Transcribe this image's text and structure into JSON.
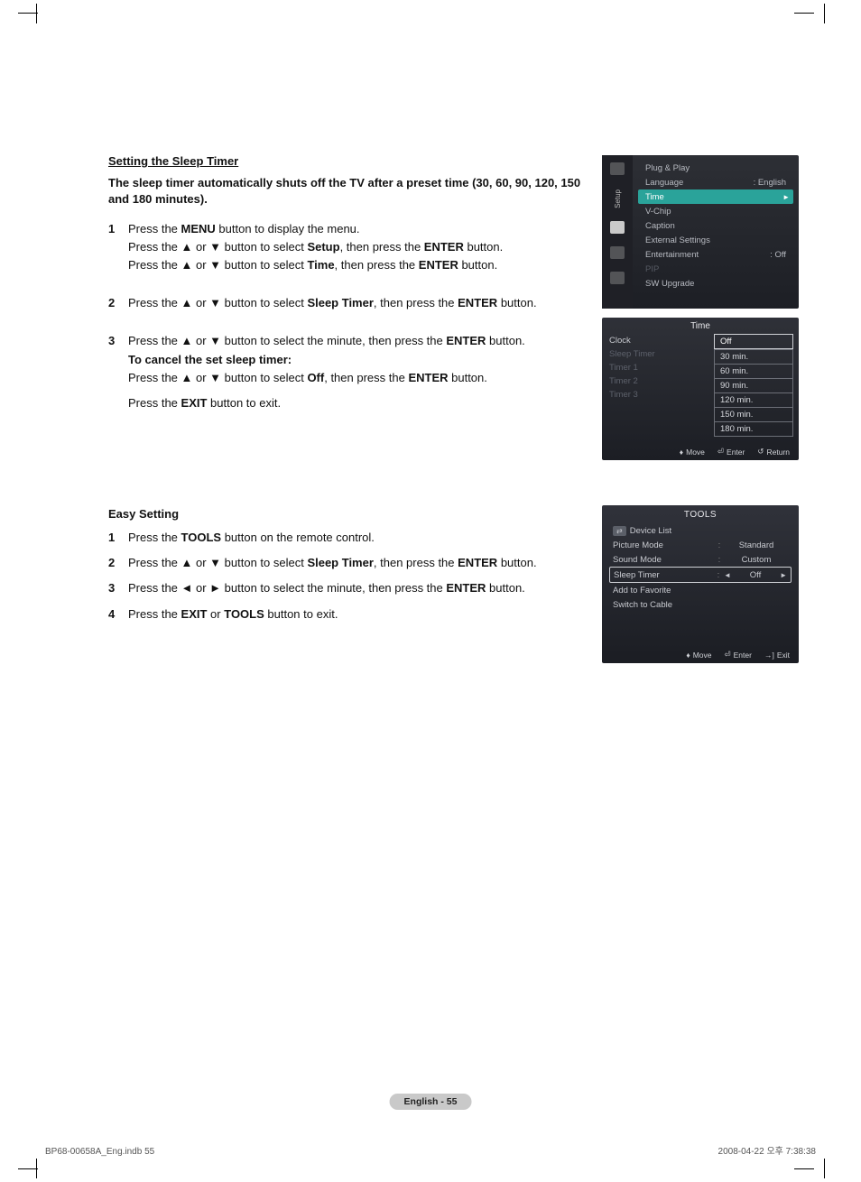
{
  "section1": {
    "title": "Setting the Sleep Timer",
    "intro": "The sleep timer automatically shuts off the TV after a preset time (30, 60, 90, 120, 150 and 180 minutes).",
    "steps": [
      {
        "num": "1",
        "lines": [
          {
            "pre": "Press the ",
            "b": "MENU",
            "post": " button to display the menu."
          },
          {
            "pre": "Press the ▲ or ▼ button to select ",
            "b": "Setup",
            "mid": ", then press the ",
            "b2": "ENTER",
            "post": " button."
          },
          {
            "pre": "Press the ▲ or ▼ button to select ",
            "b": "Time",
            "mid": ", then press the ",
            "b2": "ENTER",
            "post": " button."
          }
        ]
      },
      {
        "num": "2",
        "lines": [
          {
            "pre": "Press the ▲ or ▼ button to select ",
            "b": "Sleep Timer",
            "mid": ", then press the ",
            "b2": "ENTER",
            "post": " button."
          }
        ]
      },
      {
        "num": "3",
        "lines": [
          {
            "pre": "Press the ▲ or ▼ button to select the minute, then press the ",
            "b": "ENTER",
            "post": " button."
          },
          {
            "boldline": "To cancel the set sleep timer:"
          },
          {
            "pre": "Press the ▲ or ▼ button to select ",
            "b": "Off",
            "mid": ", then press the ",
            "b2": "ENTER",
            "post": " button."
          },
          {
            "spacer": true
          },
          {
            "pre": "Press the ",
            "b": "EXIT",
            "post": " button to exit."
          }
        ]
      }
    ]
  },
  "section2": {
    "title": "Easy Setting",
    "steps": [
      {
        "num": "1",
        "pre": "Press the ",
        "b": "TOOLS",
        "post": " button on the remote control."
      },
      {
        "num": "2",
        "pre": "Press the ▲ or ▼ button to select ",
        "b": "Sleep Timer",
        "mid": ", then press the ",
        "b2": "ENTER",
        "post": " button."
      },
      {
        "num": "3",
        "pre": "Press the ◄ or ► button to select the minute, then press the ",
        "b": "ENTER",
        "post": " button."
      },
      {
        "num": "4",
        "pre": "Press the ",
        "b": "EXIT",
        "mid": " or ",
        "b2": "TOOLS",
        "post": " button to exit."
      }
    ]
  },
  "osd_setup": {
    "sidebar_label": "Setup",
    "items": [
      {
        "label": "Plug & Play",
        "val": ""
      },
      {
        "label": "Language",
        "val": ": English"
      },
      {
        "label": "Time",
        "val": "",
        "sel": true
      },
      {
        "label": "V-Chip",
        "val": ""
      },
      {
        "label": "Caption",
        "val": ""
      },
      {
        "label": "External Settings",
        "val": ""
      },
      {
        "label": "Entertainment",
        "val": ": Off"
      },
      {
        "label": "PIP",
        "val": "",
        "dim": true
      },
      {
        "label": "SW Upgrade",
        "val": ""
      }
    ]
  },
  "osd_time": {
    "title": "Time",
    "left": [
      "Clock",
      "Sleep Timer",
      "Timer 1",
      "Timer 2",
      "Timer 3"
    ],
    "options": [
      "Off",
      "30 min.",
      "60 min.",
      "90 min.",
      "120 min.",
      "150 min.",
      "180 min."
    ],
    "footer": {
      "move": "Move",
      "enter": "Enter",
      "return": "Return"
    }
  },
  "osd_tools": {
    "title": "TOOLS",
    "rows": [
      {
        "label": "Device List",
        "src": true
      },
      {
        "label": "Picture Mode",
        "val": "Standard"
      },
      {
        "label": "Sound Mode",
        "val": "Custom"
      },
      {
        "label": "Sleep Timer",
        "val": "Off",
        "sel": true
      },
      {
        "label": "Add to Favorite"
      },
      {
        "label": "Switch to Cable"
      }
    ],
    "footer": {
      "move": "Move",
      "enter": "Enter",
      "exit": "Exit"
    }
  },
  "page_number": "English - 55",
  "footer_file": "BP68-00658A_Eng.indb   55",
  "footer_date": "2008-04-22   오후 7:38:38"
}
